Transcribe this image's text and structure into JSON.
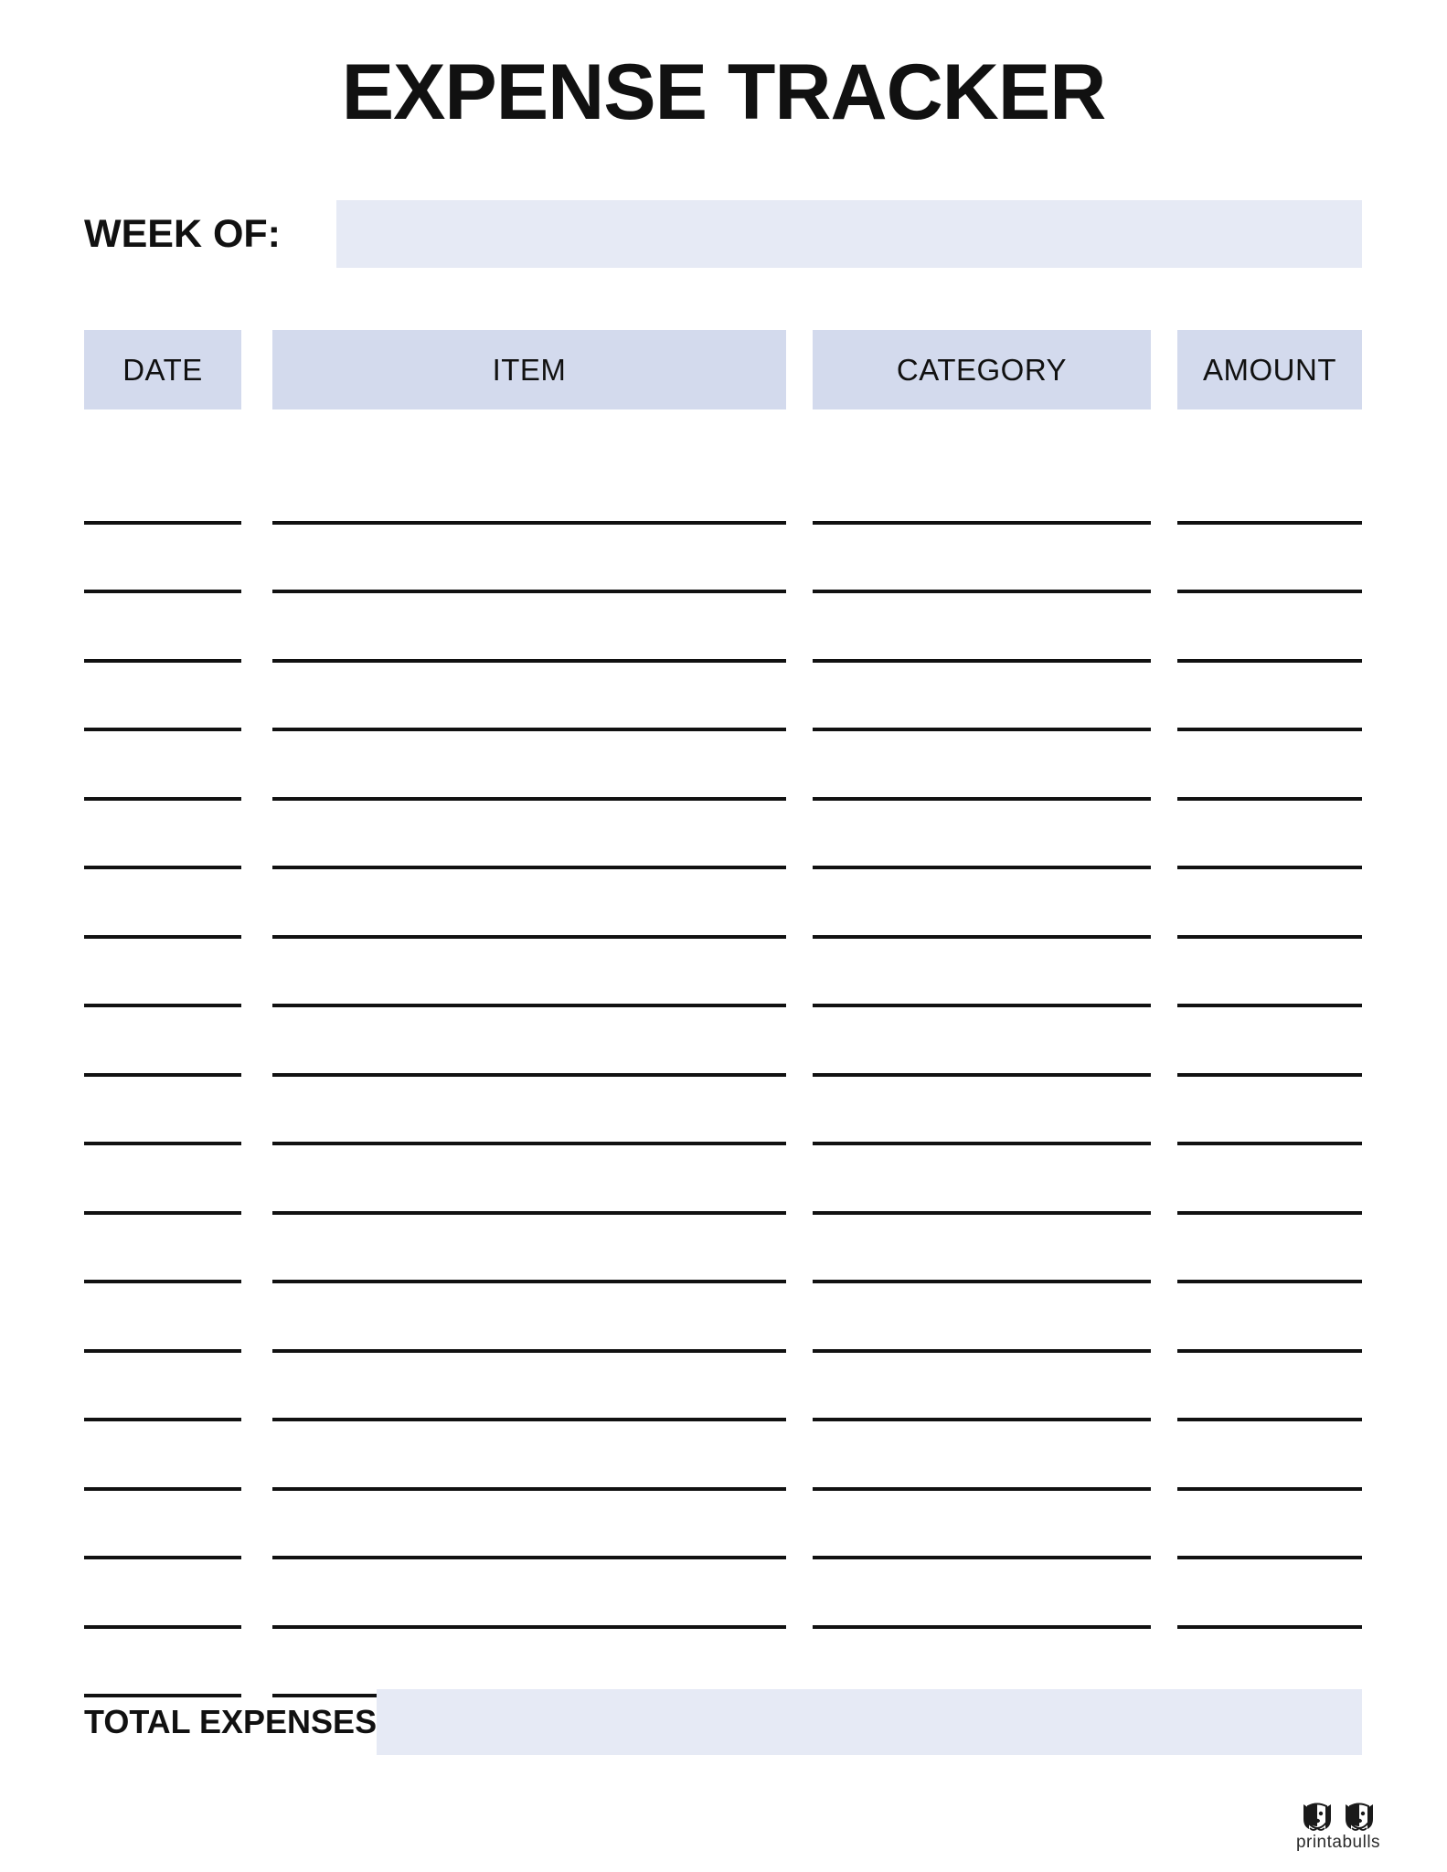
{
  "document": {
    "title": "EXPENSE TRACKER"
  },
  "week_of": {
    "label": "WEEK OF:",
    "value": "",
    "placeholder": ""
  },
  "table": {
    "columns": [
      {
        "key": "date",
        "label": "DATE"
      },
      {
        "key": "item",
        "label": "ITEM"
      },
      {
        "key": "category",
        "label": "CATEGORY"
      },
      {
        "key": "amount",
        "label": "AMOUNT"
      }
    ],
    "row_count": 18,
    "rows": [
      {
        "date": "",
        "item": "",
        "category": "",
        "amount": ""
      },
      {
        "date": "",
        "item": "",
        "category": "",
        "amount": ""
      },
      {
        "date": "",
        "item": "",
        "category": "",
        "amount": ""
      },
      {
        "date": "",
        "item": "",
        "category": "",
        "amount": ""
      },
      {
        "date": "",
        "item": "",
        "category": "",
        "amount": ""
      },
      {
        "date": "",
        "item": "",
        "category": "",
        "amount": ""
      },
      {
        "date": "",
        "item": "",
        "category": "",
        "amount": ""
      },
      {
        "date": "",
        "item": "",
        "category": "",
        "amount": ""
      },
      {
        "date": "",
        "item": "",
        "category": "",
        "amount": ""
      },
      {
        "date": "",
        "item": "",
        "category": "",
        "amount": ""
      },
      {
        "date": "",
        "item": "",
        "category": "",
        "amount": ""
      },
      {
        "date": "",
        "item": "",
        "category": "",
        "amount": ""
      },
      {
        "date": "",
        "item": "",
        "category": "",
        "amount": ""
      },
      {
        "date": "",
        "item": "",
        "category": "",
        "amount": ""
      },
      {
        "date": "",
        "item": "",
        "category": "",
        "amount": ""
      },
      {
        "date": "",
        "item": "",
        "category": "",
        "amount": ""
      },
      {
        "date": "",
        "item": "",
        "category": "",
        "amount": ""
      },
      {
        "date": "",
        "item": "",
        "category": "",
        "amount": ""
      }
    ]
  },
  "total": {
    "label": "TOTAL EXPENSES:",
    "value": "",
    "placeholder": ""
  },
  "branding": {
    "name": "printabulls",
    "mark": "two-bulldog-faces-icon"
  },
  "colors": {
    "header_fill": "#d3daed",
    "field_fill": "#e6eaf5",
    "line": "#111111",
    "text": "#111111",
    "page_background": "#ffffff"
  }
}
